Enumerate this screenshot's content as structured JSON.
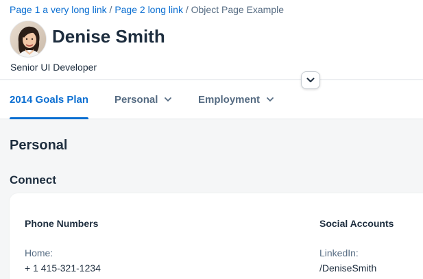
{
  "breadcrumb": {
    "links": [
      "Page 1 a very long link",
      "Page 2 long link"
    ],
    "separator": "/",
    "current": "Object Page Example"
  },
  "header": {
    "title": "Denise Smith",
    "subtitle": "Senior UI Developer",
    "avatar_icon": "person-avatar-photo"
  },
  "tabs": [
    {
      "label": "2014 Goals Plan",
      "selected": true
    },
    {
      "label": "Personal",
      "dropdown": true
    },
    {
      "label": "Employment",
      "dropdown": true
    }
  ],
  "section": {
    "title": "Personal",
    "subsection": "Connect",
    "groups": [
      {
        "title": "Phone Numbers",
        "label": "Home:",
        "value": "+ 1 415-321-1234"
      },
      {
        "title": "Social Accounts",
        "label": "LinkedIn:",
        "value": "/DeniseSmith"
      }
    ]
  },
  "colors": {
    "accent": "#0a6ed1",
    "text": "#1d2d3e",
    "muted": "#556b82",
    "background": "#f5f6f7"
  }
}
